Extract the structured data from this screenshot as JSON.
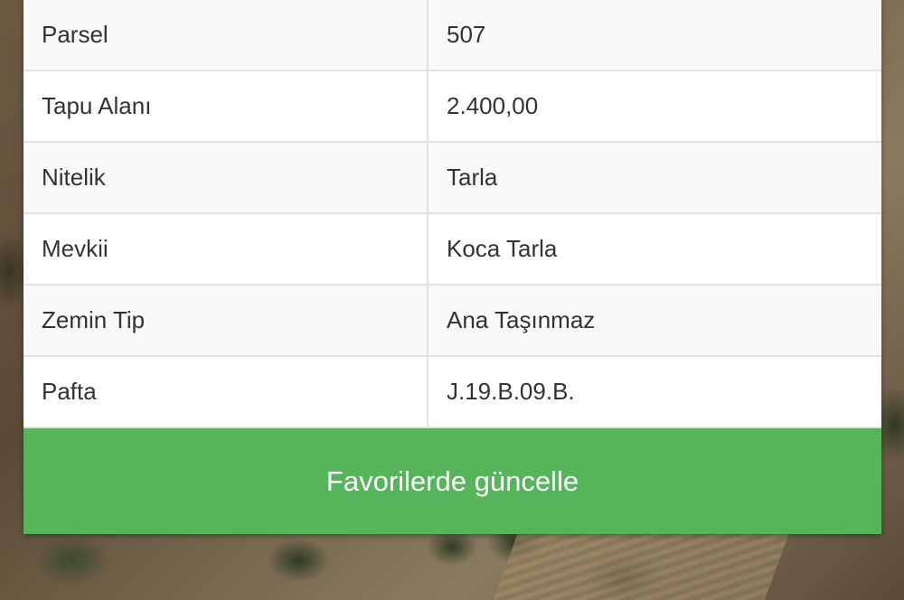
{
  "details": {
    "rows": [
      {
        "label": "Parsel",
        "value": "507"
      },
      {
        "label": "Tapu Alanı",
        "value": "2.400,00"
      },
      {
        "label": "Nitelik",
        "value": "Tarla"
      },
      {
        "label": "Mevkii",
        "value": "Koca Tarla"
      },
      {
        "label": "Zemin Tip",
        "value": "Ana Taşınmaz"
      },
      {
        "label": "Pafta",
        "value": "J.19.B.09.B."
      }
    ]
  },
  "actions": {
    "update_label": "Favorilerde güncelle"
  },
  "colors": {
    "button_bg": "#56b45a",
    "button_text": "#ffffff",
    "row_alt": "#f9f9f9"
  }
}
